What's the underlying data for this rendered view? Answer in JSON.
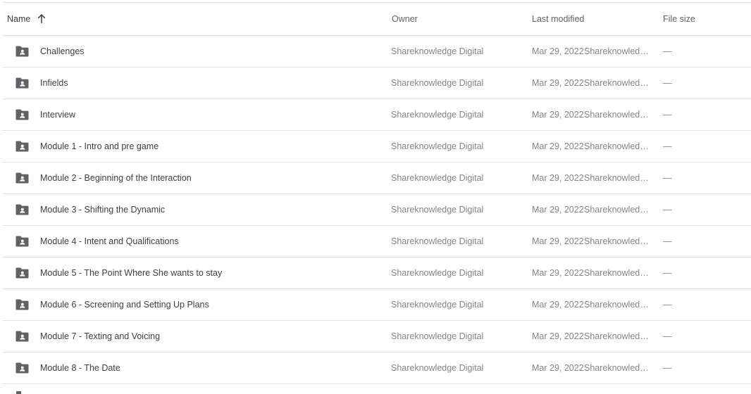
{
  "header": {
    "name_label": "Name",
    "owner_label": "Owner",
    "modified_label": "Last modified",
    "size_label": "File size",
    "sort_icon": "arrow-up-icon"
  },
  "folder_icon": "shared-folder-icon",
  "rows": [
    {
      "name": "Challenges",
      "owner": "Shareknowledge Digital",
      "date": "Mar 29, 2022",
      "modified_by": "Shareknowledge Digital",
      "size": "—"
    },
    {
      "name": "Infields",
      "owner": "Shareknowledge Digital",
      "date": "Mar 29, 2022",
      "modified_by": "Shareknowledge Digital",
      "size": "—"
    },
    {
      "name": "Interview",
      "owner": "Shareknowledge Digital",
      "date": "Mar 29, 2022",
      "modified_by": "Shareknowledge Digital",
      "size": "—"
    },
    {
      "name": "Module 1 - Intro and pre game",
      "owner": "Shareknowledge Digital",
      "date": "Mar 29, 2022",
      "modified_by": "Shareknowledge Digital",
      "size": "—"
    },
    {
      "name": "Module 2 - Beginning of the Interaction",
      "owner": "Shareknowledge Digital",
      "date": "Mar 29, 2022",
      "modified_by": "Shareknowledge Digital",
      "size": "—"
    },
    {
      "name": "Module 3 - Shifting the Dynamic",
      "owner": "Shareknowledge Digital",
      "date": "Mar 29, 2022",
      "modified_by": "Shareknowledge Digital",
      "size": "—"
    },
    {
      "name": "Module 4 - Intent and Qualifications",
      "owner": "Shareknowledge Digital",
      "date": "Mar 29, 2022",
      "modified_by": "Shareknowledge Digital",
      "size": "—"
    },
    {
      "name": "Module 5 - The Point Where She wants to stay",
      "owner": "Shareknowledge Digital",
      "date": "Mar 29, 2022",
      "modified_by": "Shareknowledge Digital",
      "size": "—"
    },
    {
      "name": "Module 6 - Screening and Setting Up Plans",
      "owner": "Shareknowledge Digital",
      "date": "Mar 29, 2022",
      "modified_by": "Shareknowledge Digital",
      "size": "—"
    },
    {
      "name": "Module 7 - Texting and Voicing",
      "owner": "Shareknowledge Digital",
      "date": "Mar 29, 2022",
      "modified_by": "Shareknowledge Digital",
      "size": "—"
    },
    {
      "name": "Module 8 - The Date",
      "owner": "Shareknowledge Digital",
      "date": "Mar 29, 2022",
      "modified_by": "Shareknowledge Digital",
      "size": "—"
    }
  ]
}
